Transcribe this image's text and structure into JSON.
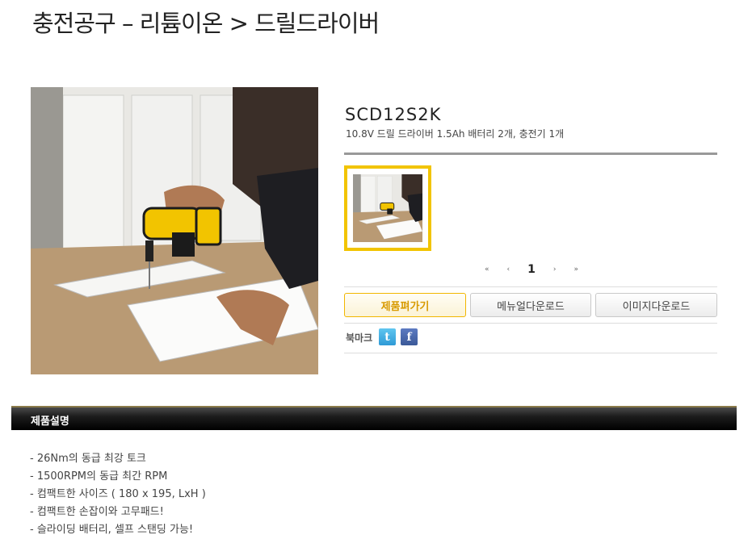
{
  "header": {
    "title": "충전공구 – 리튬이온 > 드릴드라이버"
  },
  "product": {
    "code": "SCD12S2K",
    "description": "10.8V 드릴 드라이버 1.5Ah 배터리 2개, 충전기 1개"
  },
  "pager": {
    "first_icon": "«",
    "prev_icon": "‹",
    "current": "1",
    "next_icon": "›",
    "last_icon": "»"
  },
  "buttons": {
    "open_product": "제품펴가기",
    "manual_download": "메뉴얼다운로드",
    "image_download": "이미지다운로드"
  },
  "bookmark": {
    "label": "북마크",
    "twitter_icon": "t",
    "facebook_icon": "f"
  },
  "section": {
    "title": "제품설명"
  },
  "features": [
    "- 26Nm의 동급 최강 토크",
    "- 1500RPM의 동급 최간 RPM",
    "- 컴팩트한 사이즈 ( 180 x 195,   LxH )",
    "- 컴팩트한 손잡이와 고무패드!",
    "- 슬라이딩 배터리, 셀프 스탠딩 가능!"
  ],
  "colors": {
    "accent": "#f2c400",
    "twitter": "#2f9ad6",
    "facebook": "#3b5998"
  }
}
